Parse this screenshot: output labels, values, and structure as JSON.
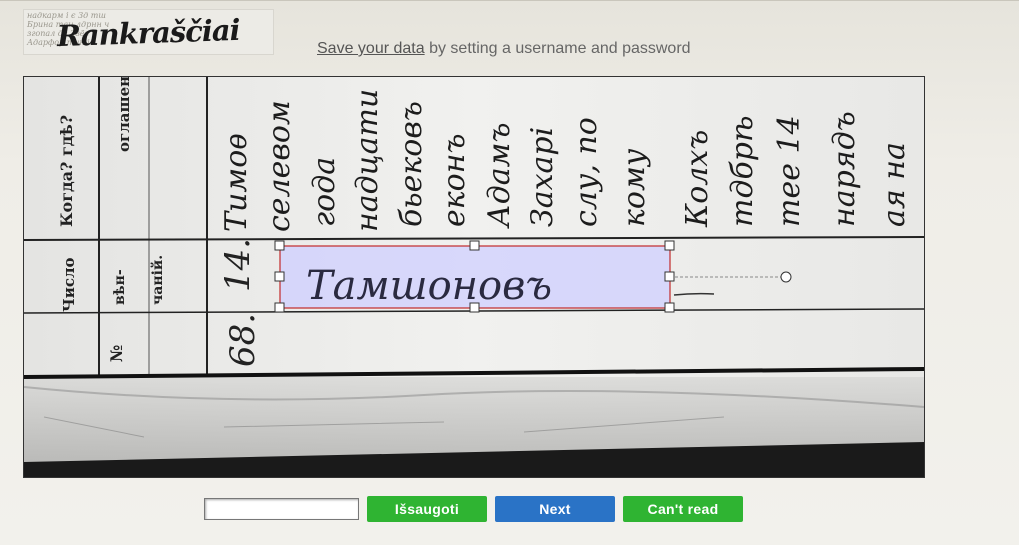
{
  "logo": {
    "text": "Rankraščiai",
    "background_script": "надкарм і є 3д тш\nБрина тан лдрнн ч\nзгопал де Звёз\nАдарфор тчн і"
  },
  "header": {
    "save_link": "Save your data",
    "save_rest": " by setting a username and password"
  },
  "document": {
    "header_labels": [
      "Когда? гдѣ?",
      "оглашені",
      "Число",
      "вѣн-",
      "чаній.",
      "№"
    ],
    "row_values": [
      "14.",
      "68."
    ],
    "column_words": [
      "Тимоѳ",
      "селевом",
      "года",
      "надцати",
      "бьековъ",
      "еконъ",
      "Адамъ",
      "Захарі",
      "слу, по",
      "кому",
      "Колхъ",
      "тдбрѣ",
      "тее 14",
      "нарядъ",
      "ая на"
    ],
    "selected_word": "Тамшоновъ"
  },
  "controls": {
    "answer_value": "",
    "save_label": "Išsaugoti",
    "next_label": "Next",
    "cant_read_label": "Can't read"
  },
  "colors": {
    "green_button": "#2fb432",
    "blue_button": "#2a73c6",
    "selection_fill": "#cfcfff",
    "selection_border": "#c22a2a"
  }
}
